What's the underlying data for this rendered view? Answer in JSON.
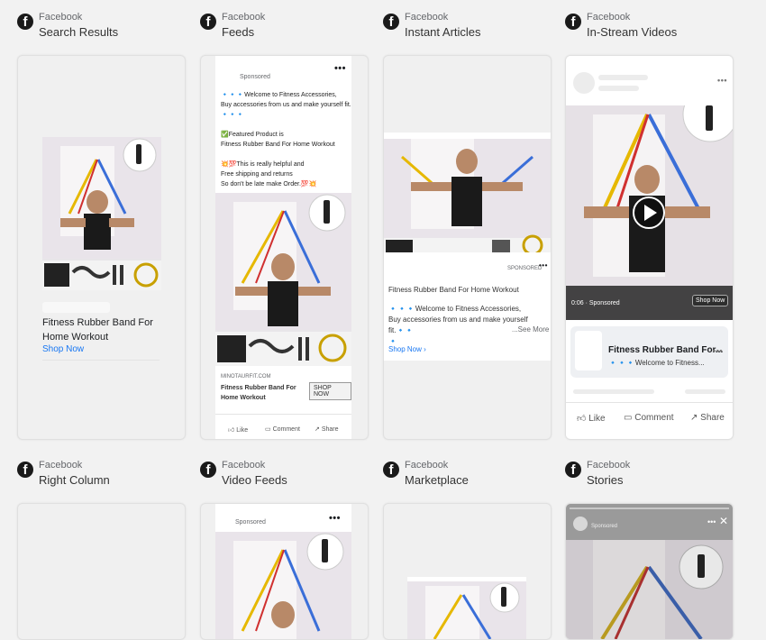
{
  "platform": "Facebook",
  "placements": [
    {
      "title": "Search Results"
    },
    {
      "title": "Feeds"
    },
    {
      "title": "Instant Articles"
    },
    {
      "title": "In-Stream Videos"
    },
    {
      "title": "Right Column"
    },
    {
      "title": "Video Feeds"
    },
    {
      "title": "Marketplace"
    },
    {
      "title": "Stories"
    }
  ],
  "ad": {
    "headline": "Fitness Rubber Band For Home Workout",
    "headline_line1": "Fitness Rubber Band For",
    "headline_line2": "Home Workout",
    "headline_short": "Fitness Rubber Band For...",
    "cta": "Shop Now",
    "cta_upper": "SHOP NOW",
    "sponsored": "Sponsored",
    "sponsored_upper": "SPONSORED",
    "domain": "MINOTAURFIT.COM",
    "feed_lines": [
      "🔹🔹🔹Welcome to Fitness Accessories,",
      "Buy accessories from us and make yourself fit.",
      "🔹🔹🔹",
      "",
      "✅Featured Product is",
      "Fitness Rubber Band For Home Workout",
      "",
      "💥💯This is really helpful and",
      "Free shipping and returns",
      "So don't be late make Order.💯💥"
    ],
    "article_line1": "🔹🔹🔹Welcome to Fitness Accessories,",
    "article_line2": "Buy accessories from us and make yourself fit.🔹🔹",
    "article_line3": "🔹",
    "see_more": "...See More",
    "welcome_short": "🔹🔹🔹Welcome to Fitness...",
    "video_time": "0:06 · Sponsored",
    "video_cta": "Shop Now"
  },
  "actions": {
    "like": "Like",
    "comment": "Comment",
    "share": "Share"
  }
}
